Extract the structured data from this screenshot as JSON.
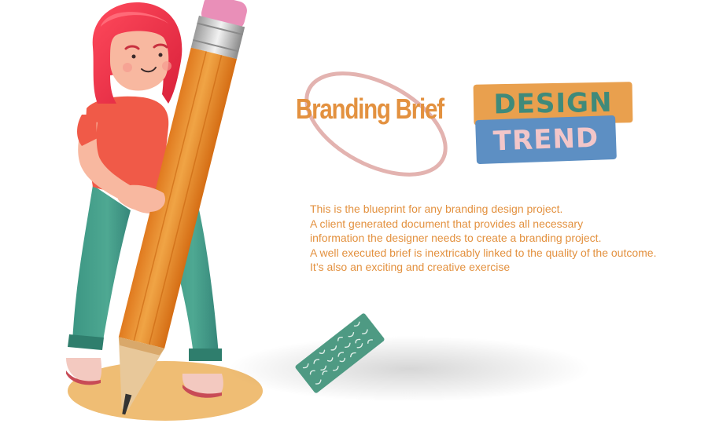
{
  "heading": {
    "title": "Branding Brief",
    "badge_top": "DESIGN",
    "badge_bottom": "TREND"
  },
  "description": {
    "lines": [
      "This is the blueprint for any branding design project.",
      "A client generated document that provides all necessary",
      "information the designer needs to create a branding project.",
      "A well executed brief is inextricably linked to the quality of the outcome.",
      "It’s also an exciting and creative exercise"
    ]
  },
  "colors": {
    "accent_orange": "#e3913f",
    "badge_orange": "#e9a04e",
    "badge_blue": "#5d8fc3",
    "badge_teal_text": "#3f8a7a",
    "badge_pink_text": "#f2c6c9",
    "ellipse_pink": "#e3b3b0",
    "ground_ellipse": "#efbd74"
  },
  "illustration": {
    "subject": "woman-hugging-giant-pencil",
    "props": [
      "pencil",
      "patterned-card"
    ]
  }
}
